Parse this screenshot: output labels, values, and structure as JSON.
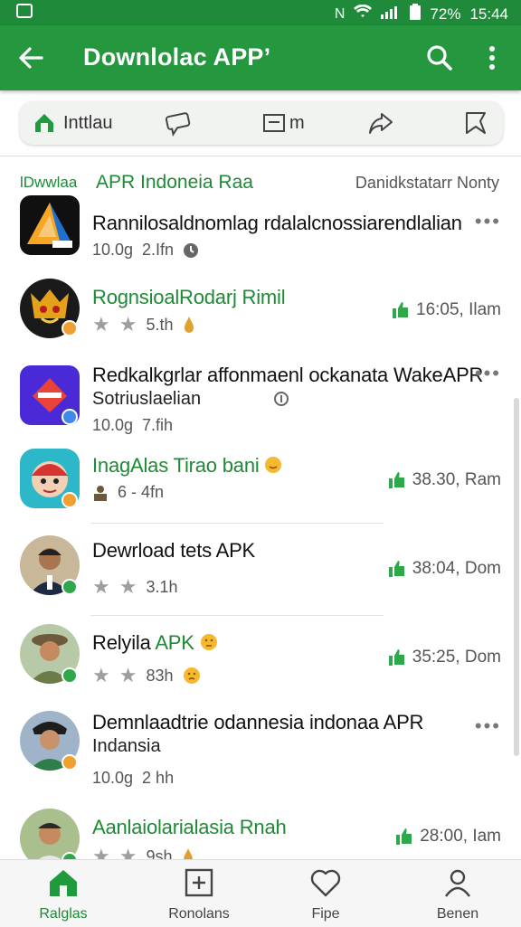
{
  "status_bar": {
    "network": "N",
    "battery_text": "72%",
    "time": "15:44"
  },
  "app_bar": {
    "title": "Downlolac APP’",
    "back_icon": "arrow-left-icon",
    "search_icon": "search-icon",
    "more_icon": "more-vert-icon"
  },
  "filters": [
    {
      "label": "Inttlau",
      "icon": "install-icon"
    },
    {
      "label": "",
      "icon": "chat-bubble-icon"
    },
    {
      "label": "m",
      "icon": "list-icon"
    },
    {
      "label": "",
      "icon": "share-arrow-icon"
    },
    {
      "label": "",
      "icon": "bookmark-icon"
    }
  ],
  "section": {
    "left": "lDwwlaa",
    "title": "APR Indoneia Raa",
    "right": "Danidkstatarr Nonty"
  },
  "items": [
    {
      "title": "Rannilosaldnomlag rdalalcnossiarendlalian",
      "meta1": "10.0g",
      "meta2": "2.Ifn",
      "time": "",
      "title_color": "#111111"
    },
    {
      "title": "RognsioalRodarj Rimil",
      "meta1": "",
      "meta2": "5.th",
      "time": "16:05, Ilam",
      "title_color": "#1e8a35"
    },
    {
      "title": "Redkalkgrlar affonmaenl ockanata WakeAPR",
      "subtitle": "Sotriuslaelian",
      "meta1": "10.0g",
      "meta2": "7.fih",
      "time": "",
      "title_color": "#111111"
    },
    {
      "title": "InagAlas Tirao bani",
      "meta1": "6 - 4fn",
      "meta2": "",
      "time": "38.30, Ram",
      "title_color": "#1e8a35"
    },
    {
      "title": "Dewrload tets APK",
      "meta1": "",
      "meta2": "3.1h",
      "time": "38:04, Dom",
      "title_color": "#111111"
    },
    {
      "title": "Relyila",
      "title_suffix": "APK",
      "meta1": "",
      "meta2": "83h",
      "time": "35:25, Dom",
      "title_color": "#111111"
    },
    {
      "title": "Demnlaadtrie odannesia indonaa APR",
      "subtitle": "Indansia",
      "meta1": "10.0g",
      "meta2": "2 hh",
      "time": "",
      "title_color": "#111111"
    },
    {
      "title": "Aanlaiolarialasia Rnah",
      "meta1": "",
      "meta2": "9sh",
      "time": "28:00, Iam",
      "title_color": "#1e8a35"
    }
  ],
  "bottom_nav": [
    {
      "label": "Ralglas",
      "icon": "home-icon",
      "active": true
    },
    {
      "label": "Ronolans",
      "icon": "apps-icon",
      "active": false
    },
    {
      "label": "Fipe",
      "icon": "heart-icon",
      "active": false
    },
    {
      "label": "Benen",
      "icon": "person-icon",
      "active": false
    }
  ],
  "colors": {
    "primary": "#24973f",
    "accent_text": "#1e8a35",
    "badge_orange": "#f0a030",
    "badge_green": "#2ea84a",
    "badge_blue": "#3d8be8"
  }
}
